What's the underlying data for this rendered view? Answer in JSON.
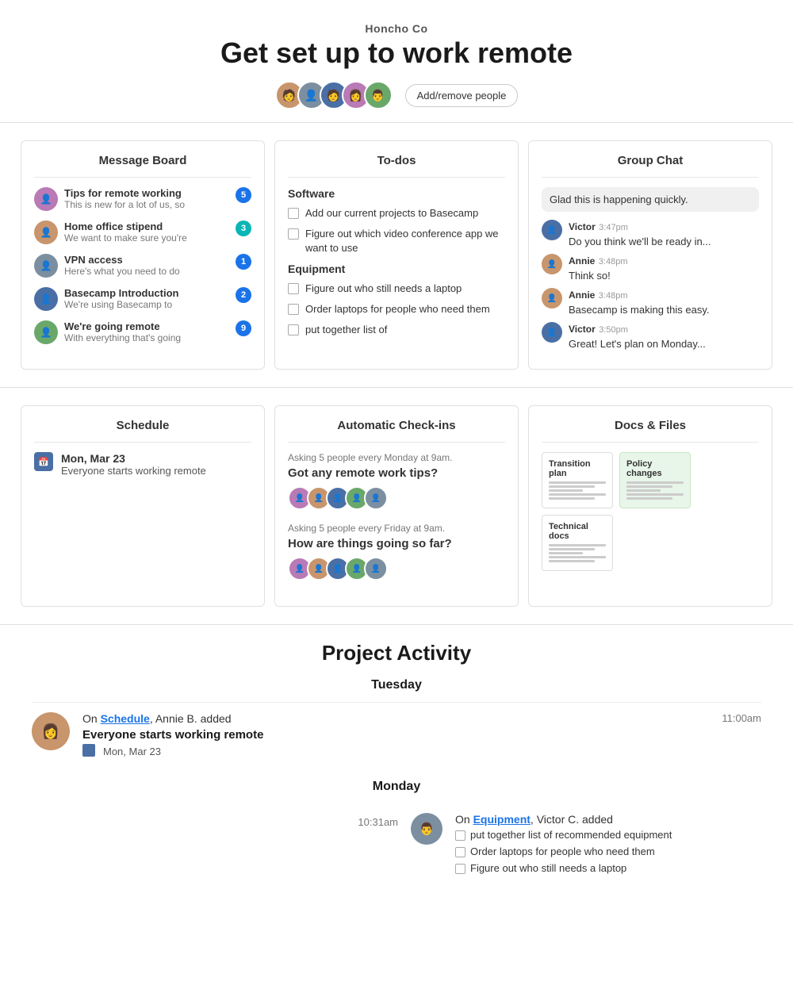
{
  "header": {
    "company": "Honcho Co",
    "title": "Get set up to work remote",
    "add_people_label": "Add/remove people"
  },
  "message_board": {
    "title": "Message Board",
    "items": [
      {
        "title": "Tips for remote working",
        "preview": "This is new for a lot of us, so",
        "badge": "5",
        "badge_color": "blue",
        "avatar_color": "#b97ab5"
      },
      {
        "title": "Home office stipend",
        "preview": "We want to make sure you're",
        "badge": "3",
        "badge_color": "teal",
        "avatar_color": "#c8956c"
      },
      {
        "title": "VPN access",
        "preview": "Here's what you need to do",
        "badge": "1",
        "badge_color": "blue",
        "avatar_color": "#7b8fa0"
      },
      {
        "title": "Basecamp Introduction",
        "preview": "We're using Basecamp to",
        "badge": "2",
        "badge_color": "blue",
        "avatar_color": "#4a6fa5"
      },
      {
        "title": "We're going remote",
        "preview": "With everything that's going",
        "badge": "9",
        "badge_color": "blue",
        "avatar_color": "#6aa86a"
      }
    ]
  },
  "todos": {
    "title": "To-dos",
    "sections": [
      {
        "name": "Software",
        "items": [
          "Add our current projects to Basecamp",
          "Figure out which video conference app we want to use"
        ]
      },
      {
        "name": "Equipment",
        "items": [
          "Figure out who still needs a laptop",
          "Order laptops for people who need them",
          "put together list of"
        ]
      }
    ]
  },
  "group_chat": {
    "title": "Group Chat",
    "messages": [
      {
        "sender": null,
        "time": null,
        "text": "Glad this is happening quickly.",
        "avatar_color": "#b97ab5",
        "is_bubble": true
      },
      {
        "sender": "Victor",
        "time": "3:47pm",
        "text": "Do you think we'll be ready in...",
        "avatar_color": "#4a6fa5"
      },
      {
        "sender": "Annie",
        "time": "3:48pm",
        "text": "Think so!",
        "avatar_color": "#c8956c"
      },
      {
        "sender": "Annie",
        "time": "3:48pm",
        "text": "Basecamp is making this easy.",
        "avatar_color": "#c8956c"
      },
      {
        "sender": "Victor",
        "time": "3:50pm",
        "text": "Great! Let's plan on Monday...",
        "avatar_color": "#4a6fa5"
      }
    ]
  },
  "schedule": {
    "title": "Schedule",
    "items": [
      {
        "date": "Mon, Mar 23",
        "description": "Everyone starts working remote"
      }
    ]
  },
  "checkins": {
    "title": "Automatic Check-ins",
    "items": [
      {
        "meta": "Asking 5 people every Monday at 9am.",
        "question": "Got any remote work tips?"
      },
      {
        "meta": "Asking 5 people every Friday at 9am.",
        "question": "How are things going so far?"
      }
    ]
  },
  "docs": {
    "title": "Docs & Files",
    "files": [
      {
        "title": "Transition plan",
        "bg": "white"
      },
      {
        "title": "Policy changes",
        "bg": "green"
      },
      {
        "title": "Technical docs",
        "bg": "white"
      }
    ]
  },
  "activity": {
    "title": "Project Activity",
    "days": [
      {
        "day": "Tuesday",
        "events": [
          {
            "time": "11:00am",
            "avatar_color": "#c8956c",
            "meta_prefix": "On ",
            "meta_link": "Schedule",
            "meta_suffix": ", Annie B. added",
            "main": "Everyone starts working remote",
            "sub_date": "Mon, Mar 23"
          }
        ]
      },
      {
        "day": "Monday",
        "events": [
          {
            "time": "10:31am",
            "avatar_color": "#7b8fa0",
            "meta_prefix": "On ",
            "meta_link": "Equipment",
            "meta_suffix": ", Victor C. added",
            "todos": [
              "put together list of recommended equipment",
              "Order laptops for people who need them",
              "Figure out who still needs a laptop"
            ]
          }
        ]
      }
    ]
  }
}
